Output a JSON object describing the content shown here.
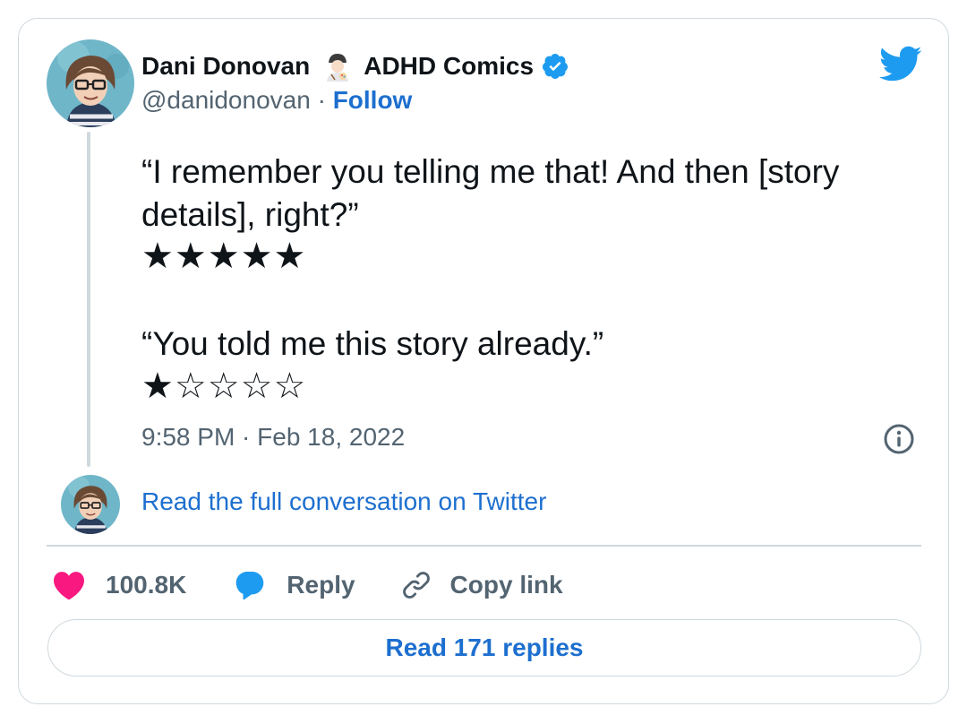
{
  "author": {
    "display_name": "Dani Donovan",
    "display_suffix": "ADHD Comics",
    "handle": "@danidonovan",
    "separator": " · ",
    "follow_label": "Follow",
    "verified": true
  },
  "tweet": {
    "text_1": "“I remember you telling me that! And then [story details], right?”",
    "stars_1": "★★★★★",
    "text_2": "“You told me this story already.”",
    "stars_2": "★☆☆☆☆",
    "timestamp": "9:58 PM · Feb 18, 2022"
  },
  "conversation_link": "Read the full conversation on Twitter",
  "actions": {
    "likes": "100.8K",
    "reply_label": "Reply",
    "copy_link_label": "Copy link"
  },
  "read_replies_label": "Read 171 replies",
  "icons": {
    "brand": "twitter-bird-icon",
    "verified": "verified-badge-icon",
    "info": "info-icon",
    "like": "heart-icon",
    "reply": "speech-bubble-icon",
    "copy": "link-icon"
  },
  "colors": {
    "twitter_blue": "#1d9bf0",
    "link_blue": "#1d6fcf",
    "like_pink": "#f91880",
    "text_primary": "#0f1419",
    "text_secondary": "#536471",
    "border": "#cfd9de"
  }
}
